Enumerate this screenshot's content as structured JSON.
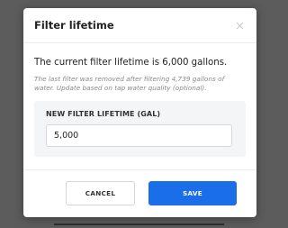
{
  "dialog": {
    "title": "Filter lifetime",
    "current_text": "The current filter lifetime is 6,000 gallons.",
    "note": "The last filter was removed after filtering 4,739 gallons of water. Update based on tap water quality (optional).",
    "field": {
      "label": "NEW FILTER LIFETIME (GAL)",
      "value": "5,000"
    },
    "buttons": {
      "cancel": "CANCEL",
      "save": "SAVE"
    },
    "icons": {
      "close": "close-icon"
    },
    "colors": {
      "primary": "#1a6eea",
      "backdrop": "#5c5c5c",
      "panel": "#f4f5f7"
    }
  }
}
